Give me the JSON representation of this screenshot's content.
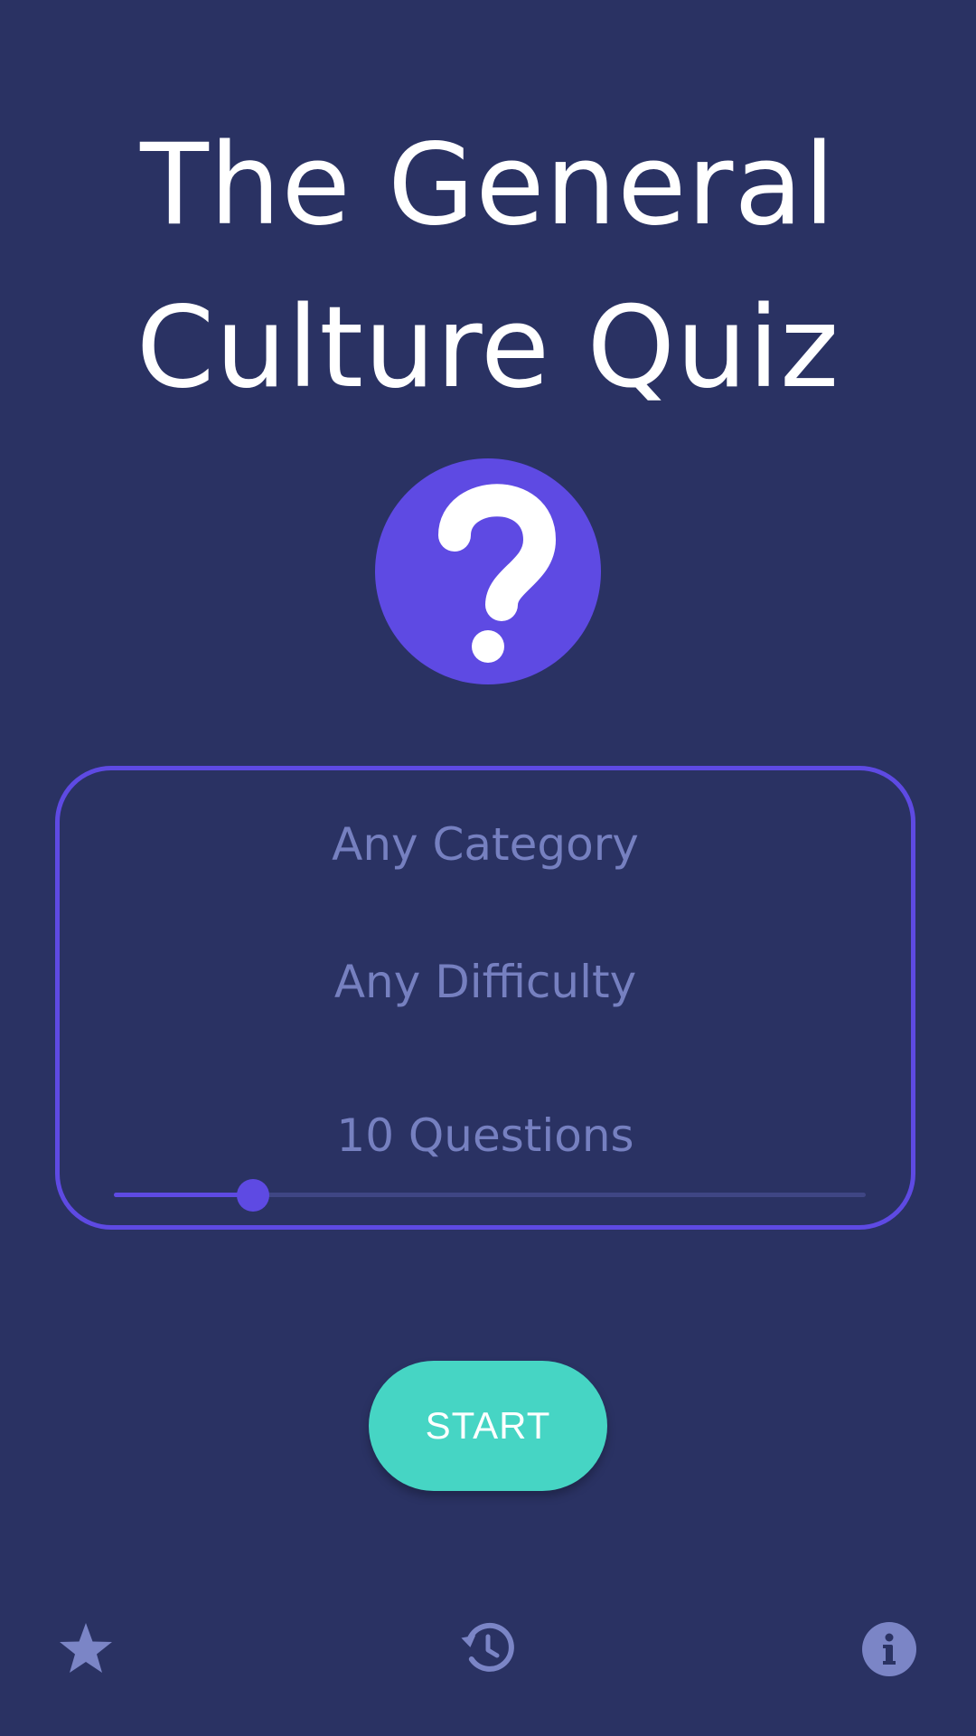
{
  "app": {
    "title_line1": "The General",
    "title_line2": "Culture Quiz",
    "logo_icon": "question-mark-icon"
  },
  "settings": {
    "category": "Any Category",
    "difficulty": "Any Difficulty",
    "question_count_label": "10 Questions",
    "question_count": 10,
    "slider_fraction": 0.185
  },
  "actions": {
    "start_label": "START"
  },
  "bottom_nav": {
    "favorites_icon": "star-icon",
    "history_icon": "history-icon",
    "info_icon": "info-icon"
  },
  "colors": {
    "background": "#2a3263",
    "accent": "#5e4ae3",
    "start_button": "#46d5c4",
    "muted_text": "#7680c0",
    "icon": "#7b85c6"
  }
}
